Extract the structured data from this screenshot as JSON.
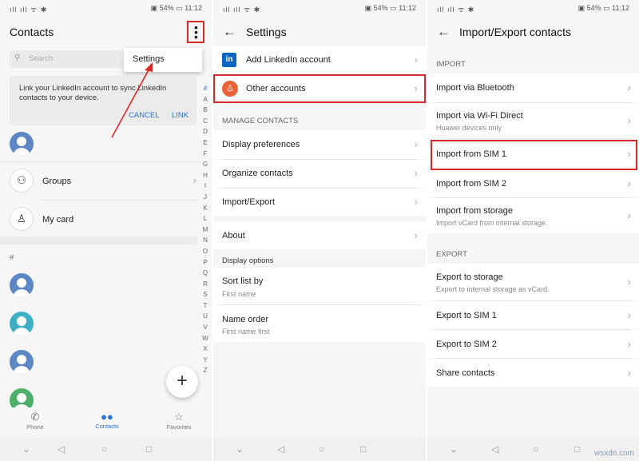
{
  "status": {
    "signal": "ıll ıll ᯤ ✱",
    "battery": "▣ 54% ▭ 11:12"
  },
  "contacts": {
    "title": "Contacts",
    "search_placeholder": "Search",
    "menu_settings": "Settings",
    "banner_text": "Link your LinkedIn account to sync LinkedIn contacts to your device.",
    "cancel": "CANCEL",
    "link": "LINK",
    "groups": "Groups",
    "my_card": "My card",
    "hash": "#",
    "alphabet": [
      "#",
      "A",
      "B",
      "C",
      "D",
      "E",
      "F",
      "G",
      "H",
      "I",
      "J",
      "K",
      "L",
      "M",
      "N",
      "O",
      "P",
      "Q",
      "R",
      "S",
      "T",
      "U",
      "V",
      "W",
      "X",
      "Y",
      "Z"
    ],
    "tabs": {
      "phone": "Phone",
      "contacts": "Contacts",
      "favorites": "Favorites"
    },
    "fab": "+"
  },
  "settings": {
    "title": "Settings",
    "linkedin_label": "Add LinkedIn account",
    "other_accounts": "Other accounts",
    "manage_header": "MANAGE CONTACTS",
    "display_prefs": "Display preferences",
    "organize": "Organize contacts",
    "import_export": "Import/Export",
    "about": "About",
    "display_options": "Display options",
    "sort_by": "Sort list by",
    "sort_by_value": "First name",
    "name_order": "Name order",
    "name_order_value": "First name first"
  },
  "importexport": {
    "title": "Import/Export contacts",
    "import_header": "IMPORT",
    "bluetooth": "Import via Bluetooth",
    "wifi_direct": "Import via Wi-Fi Direct",
    "wifi_sub": "Huawei devices only",
    "sim1": "Import from SIM 1",
    "sim2": "Import from SIM 2",
    "storage": "Import from storage",
    "storage_sub": "Import vCard from internal storage.",
    "export_header": "EXPORT",
    "exp_storage": "Export to storage",
    "exp_storage_sub": "Export to internal storage as vCard.",
    "exp_sim1": "Export to SIM 1",
    "exp_sim2": "Export to SIM 2",
    "share": "Share contacts"
  },
  "watermark": "wsxdn.com",
  "colors": {
    "accent": "#2a6fd4",
    "highlight": "#d62a2a",
    "avatar_blue": "#5c86c4",
    "avatar_teal": "#3fb0c4",
    "avatar_green": "#4caf6a",
    "linkedin": "#0a66c2",
    "accounts_icon": "#e8623a"
  }
}
